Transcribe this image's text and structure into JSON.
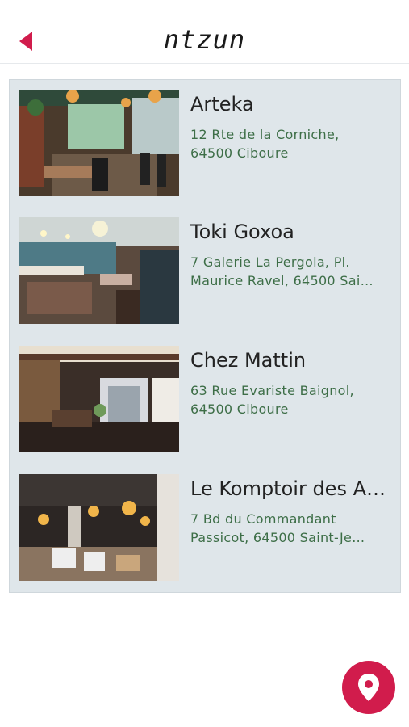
{
  "header": {
    "title": "ntzun",
    "back_icon": "back-triangle-icon",
    "accent": "#d11c4c"
  },
  "restaurants": [
    {
      "name": "Arteka",
      "address_line1": "12 Rte de la Corniche,",
      "address_line2": "64500 Ciboure"
    },
    {
      "name": "Toki Goxoa",
      "address_line1": "7 Galerie La Pergola, Pl.",
      "address_line2": "Maurice Ravel, 64500 Sai…"
    },
    {
      "name": "Chez Mattin",
      "address_line1": "63 Rue Evariste Baignol,",
      "address_line2": "64500 Ciboure"
    },
    {
      "name": "Le Komptoir des Amis",
      "address_line1": "7 Bd du Commandant",
      "address_line2": "Passicot, 64500 Saint-Je…"
    }
  ],
  "map_button": {
    "icon": "map-pin-icon",
    "color": "#d11c4c"
  }
}
